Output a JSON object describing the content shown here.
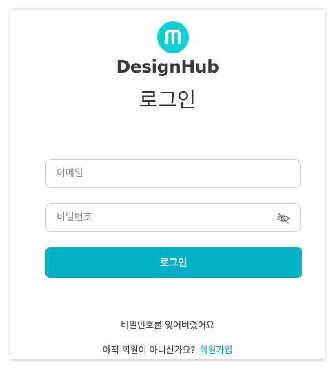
{
  "brand": {
    "name": "DesignHub",
    "logo_icon": "m-circle-logo",
    "accent_color": "#0fcfd4"
  },
  "page": {
    "title": "로그인"
  },
  "form": {
    "email_placeholder": "이메일",
    "email_value": "",
    "password_placeholder": "비밀번호",
    "password_value": "",
    "toggle_icon": "eye-off-icon",
    "submit_label": "로그인",
    "submit_color": "#00b1c6"
  },
  "footer": {
    "forgot_password": "비밀번호를 잊어버렸어요",
    "signup_prompt": "아직 회원이 아니신가요?",
    "signup_link": "회원가입",
    "link_color": "#00a3b5"
  }
}
